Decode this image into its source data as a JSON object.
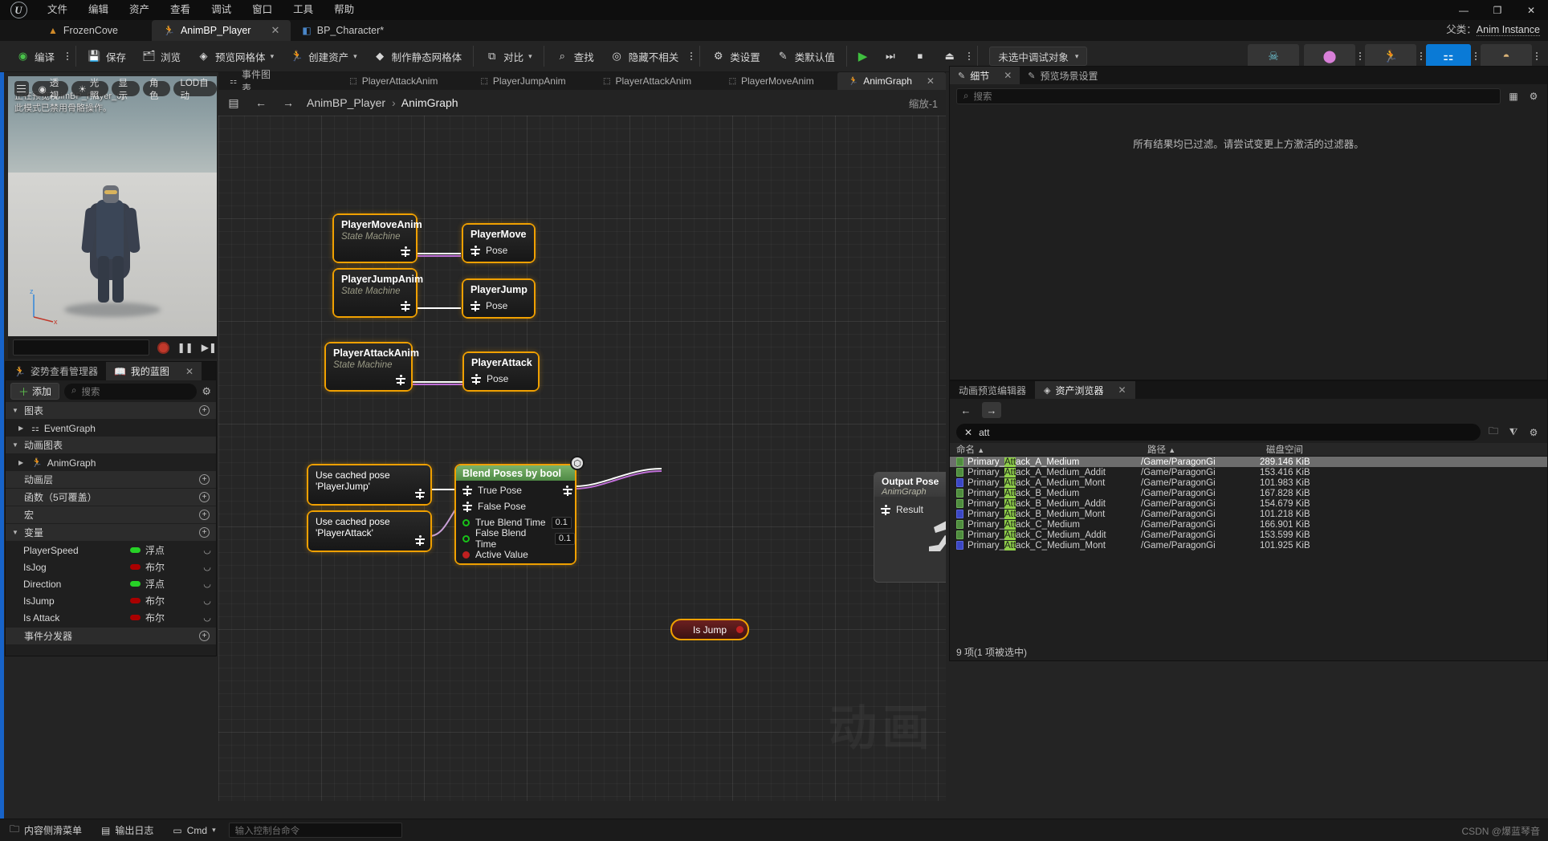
{
  "menu": {
    "logo": "ue-logo",
    "items": [
      "文件",
      "编辑",
      "资产",
      "查看",
      "调试",
      "窗口",
      "工具",
      "帮助"
    ],
    "window_controls": [
      "—",
      "❐",
      "✕"
    ]
  },
  "asset_tabs": [
    {
      "label": "FrozenCove",
      "icon": "level-icon",
      "active": false,
      "closable": false
    },
    {
      "label": "AnimBP_Player",
      "icon": "anim-blueprint-icon",
      "active": true,
      "closable": true
    },
    {
      "label": "BP_Character*",
      "icon": "blueprint-icon",
      "active": false,
      "closable": false
    }
  ],
  "parent_class": {
    "label": "父类：",
    "value": "Anim Instance"
  },
  "toolbar": {
    "compile": "编译",
    "save": "保存",
    "browse": "浏览",
    "preview_mesh": "预览网格体",
    "create_asset": "创建资产",
    "make_static_mesh": "制作静态网格体",
    "diff": "对比",
    "find": "查找",
    "hide_unrelated": "隐藏不相关",
    "class_settings": "类设置",
    "class_defaults": "类默认值",
    "debug_object": "未选中调试对象"
  },
  "viewport": {
    "overlay_text_line1": "正在预览AnimBP_Player_0。",
    "overlay_text_line2": "此模式已禁用骨骼操作。",
    "buttons": [
      "透视",
      "光照",
      "显示",
      "角色",
      "LOD自动"
    ],
    "gizmo_axes": [
      "z",
      "x"
    ]
  },
  "my_blueprint": {
    "tabs": [
      {
        "label": "姿势查看管理器",
        "icon": "pose-watch-icon",
        "active": false
      },
      {
        "label": "我的蓝图",
        "icon": "blueprint-book-icon",
        "active": true
      }
    ],
    "add_button": "添加",
    "search_placeholder": "搜索",
    "sections": [
      {
        "type": "category",
        "label": "图表",
        "expanded": true,
        "add": true
      },
      {
        "type": "item",
        "label": "EventGraph",
        "icon": "event-graph-icon"
      },
      {
        "type": "category",
        "label": "动画图表",
        "expanded": true,
        "add": false
      },
      {
        "type": "item",
        "label": "AnimGraph",
        "icon": "anim-graph-icon"
      },
      {
        "type": "category",
        "label": "动画层",
        "expanded": false,
        "add": true
      },
      {
        "type": "category",
        "label": "函数（5可覆盖）",
        "expanded": false,
        "add": true
      },
      {
        "type": "category",
        "label": "宏",
        "expanded": false,
        "add": true
      },
      {
        "type": "category",
        "label": "变量",
        "expanded": true,
        "add": true
      }
    ],
    "variables": [
      {
        "name": "PlayerSpeed",
        "type": "浮点",
        "kind": "float"
      },
      {
        "name": "IsJog",
        "type": "布尔",
        "kind": "bool"
      },
      {
        "name": "Direction",
        "type": "浮点",
        "kind": "float"
      },
      {
        "name": "IsJump",
        "type": "布尔",
        "kind": "bool"
      },
      {
        "name": "Is Attack",
        "type": "布尔",
        "kind": "bool"
      }
    ],
    "event_dispatchers": "事件分发器"
  },
  "graph": {
    "tabs": [
      {
        "label": "事件图表",
        "icon": "event-graph-icon",
        "active": false
      },
      {
        "label": "PlayerAttackAnim",
        "icon": "state-machine-icon",
        "active": false
      },
      {
        "label": "PlayerJumpAnim",
        "icon": "state-machine-icon",
        "active": false
      },
      {
        "label": "PlayerAttackAnim",
        "icon": "state-machine-icon",
        "active": false
      },
      {
        "label": "PlayerMoveAnim",
        "icon": "state-machine-icon",
        "active": false
      },
      {
        "label": "AnimGraph",
        "icon": "anim-graph-icon",
        "active": true,
        "closable": true
      }
    ],
    "breadcrumb": {
      "root": "AnimBP_Player",
      "sep": "›",
      "leaf": "AnimGraph"
    },
    "zoom_label": "缩放-1",
    "watermark": "动画",
    "nodes": [
      {
        "id": "n1",
        "title": "PlayerMoveAnim",
        "subtitle": "State Machine",
        "kind": "state-machine"
      },
      {
        "id": "n2",
        "title": "PlayerMove",
        "pin": "Pose",
        "kind": "cache-pose"
      },
      {
        "id": "n3",
        "title": "PlayerJumpAnim",
        "subtitle": "State Machine",
        "kind": "state-machine"
      },
      {
        "id": "n4",
        "title": "PlayerJump",
        "pin": "Pose",
        "kind": "cache-pose"
      },
      {
        "id": "n5",
        "title": "PlayerAttackAnim",
        "subtitle": "State Machine",
        "kind": "state-machine"
      },
      {
        "id": "n6",
        "title": "PlayerAttack",
        "pin": "Pose",
        "kind": "cache-pose"
      },
      {
        "id": "n7",
        "title": "Use cached pose 'PlayerJump'",
        "kind": "use-cached-pose"
      },
      {
        "id": "n8",
        "title": "Use cached pose 'PlayerAttack'",
        "kind": "use-cached-pose"
      }
    ],
    "blend_node": {
      "title": "Blend Poses by bool",
      "rows": [
        {
          "label": "True Pose",
          "pin": "pose"
        },
        {
          "label": "False Pose",
          "pin": "pose"
        },
        {
          "label": "True Blend Time",
          "pin": "float",
          "value": "0.1"
        },
        {
          "label": "False Blend Time",
          "pin": "float",
          "value": "0.1"
        },
        {
          "label": "Active Value",
          "pin": "bool"
        }
      ]
    },
    "bool_node": {
      "label": "Is Jump"
    },
    "output_node": {
      "title": "Output Pose",
      "subtitle": "AnimGraph",
      "pin": "Result"
    }
  },
  "details": {
    "tabs": [
      {
        "label": "细节",
        "icon": "details-icon",
        "active": true,
        "closable": true
      },
      {
        "label": "预览场景设置",
        "icon": "scene-settings-icon",
        "active": false
      }
    ],
    "search_placeholder": "搜索",
    "empty_message": "所有结果均已过滤。请尝试变更上方激活的过滤器。"
  },
  "asset_browser": {
    "tabs": [
      {
        "label": "动画预览编辑器",
        "icon": "anim-preview-icon",
        "active": false
      },
      {
        "label": "资产浏览器",
        "icon": "asset-browser-icon",
        "active": true,
        "closable": true
      }
    ],
    "search_value": "att",
    "columns": [
      "命名",
      "路径",
      "磁盘空间"
    ],
    "sort_indicator": "▲",
    "rows": [
      {
        "name": "Primary_Attack_A_Medium",
        "path": "/Game/ParagonGi",
        "size": "289.146 KiB",
        "icon": "green",
        "selected": true
      },
      {
        "name": "Primary_Attack_A_Medium_Addit",
        "path": "/Game/ParagonGi",
        "size": "153.416 KiB",
        "icon": "green",
        "selected": false
      },
      {
        "name": "Primary_Attack_A_Medium_Mont",
        "path": "/Game/ParagonGi",
        "size": "101.983 KiB",
        "icon": "blue",
        "selected": false
      },
      {
        "name": "Primary_Attack_B_Medium",
        "path": "/Game/ParagonGi",
        "size": "167.828 KiB",
        "icon": "green",
        "selected": false
      },
      {
        "name": "Primary_Attack_B_Medium_Addit",
        "path": "/Game/ParagonGi",
        "size": "154.679 KiB",
        "icon": "green",
        "selected": false
      },
      {
        "name": "Primary_Attack_B_Medium_Mont",
        "path": "/Game/ParagonGi",
        "size": "101.218 KiB",
        "icon": "blue",
        "selected": false
      },
      {
        "name": "Primary_Attack_C_Medium",
        "path": "/Game/ParagonGi",
        "size": "166.901 KiB",
        "icon": "green",
        "selected": false
      },
      {
        "name": "Primary_Attack_C_Medium_Addit",
        "path": "/Game/ParagonGi",
        "size": "153.599 KiB",
        "icon": "green",
        "selected": false
      },
      {
        "name": "Primary_Attack_C_Medium_Mont",
        "path": "/Game/ParagonGi",
        "size": "101.925 KiB",
        "icon": "blue",
        "selected": false
      }
    ],
    "highlight_term": "Att",
    "status": "9 项(1 项被选中)"
  },
  "statusbar": {
    "content_drawer": "内容侧滑菜单",
    "output_log": "输出日志",
    "cmd_label": "Cmd",
    "cmd_placeholder": "输入控制台命令",
    "watermark": "CSDN @爆蓝琴音"
  }
}
